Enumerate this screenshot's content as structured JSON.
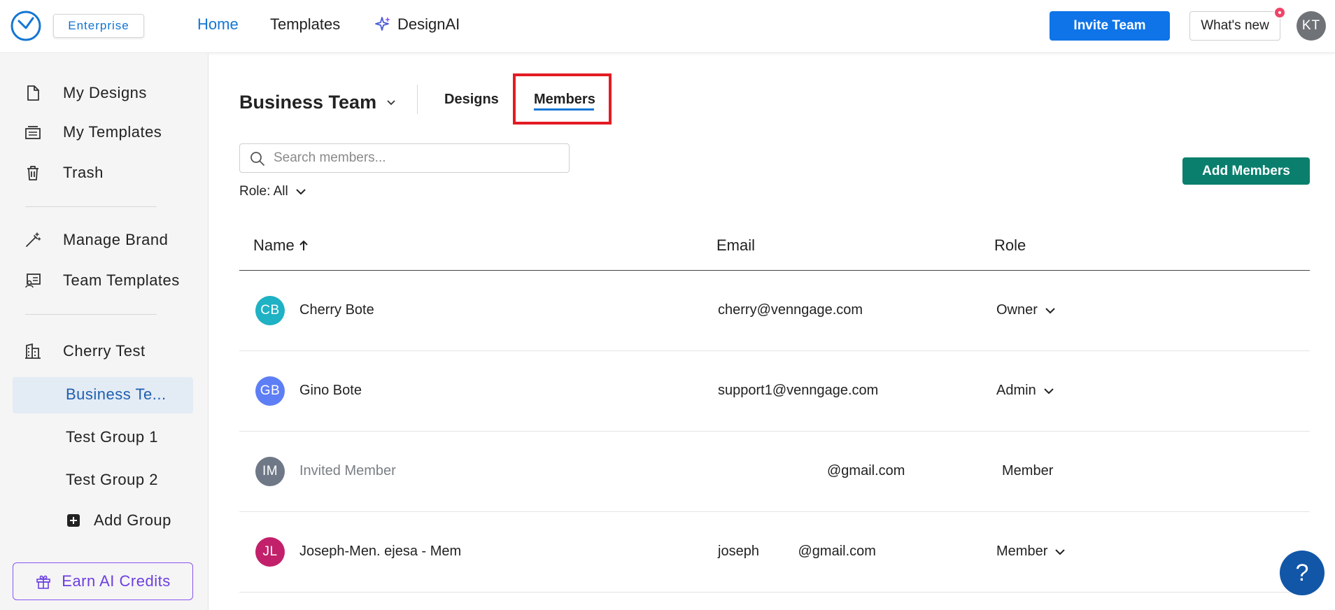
{
  "header": {
    "badge": "Enterprise",
    "nav": [
      "Home",
      "Templates",
      "DesignAI"
    ],
    "invite_label": "Invite Team",
    "whatsnew_label": "What's new",
    "avatar_initials": "KT",
    "accent": "#0e74e8"
  },
  "sidebar": {
    "items": [
      {
        "label": "My Designs",
        "icon": "file-icon"
      },
      {
        "label": "My Templates",
        "icon": "templates-icon"
      },
      {
        "label": "Trash",
        "icon": "trash-icon"
      },
      {
        "label": "Manage Brand",
        "icon": "magic-wand-icon"
      },
      {
        "label": "Team Templates",
        "icon": "team-templates-icon"
      },
      {
        "label": "Cherry Test",
        "icon": "building-icon"
      }
    ],
    "groups": [
      "Business Te...",
      "Test Group 1",
      "Test Group 2"
    ],
    "add_group_label": "Add Group",
    "credits_label": "Earn AI Credits"
  },
  "main": {
    "team_name": "Business Team",
    "tabs": [
      "Designs",
      "Members"
    ],
    "active_tab": "Members",
    "search_placeholder": "Search members...",
    "role_filter": "Role: All",
    "add_members_label": "Add Members",
    "columns": {
      "name": "Name",
      "email": "Email",
      "role": "Role"
    },
    "rows": [
      {
        "initials": "CB",
        "color": "#1fb1c4",
        "name": "Cherry Bote",
        "email": "cherry@venngage.com",
        "role": "Owner"
      },
      {
        "initials": "GB",
        "color": "#5e7ef5",
        "name": "Gino Bote",
        "email": "support1@venngage.com",
        "role": "Admin"
      },
      {
        "initials": "IM",
        "color": "#6f7886",
        "name": "Invited Member",
        "email": "@gmail.com",
        "role": "Member"
      },
      {
        "initials": "JL",
        "color": "#c2206a",
        "name": "Joseph-Men.  ejesa - Mem",
        "email": "joseph          @gmail.com",
        "role": "Member"
      }
    ]
  },
  "help_label": "?"
}
